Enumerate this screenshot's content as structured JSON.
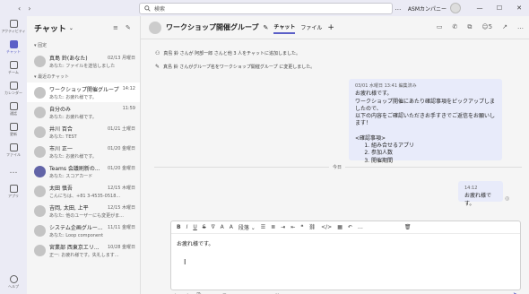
{
  "topbar": {
    "search_placeholder": "検索",
    "org_name": "ASMカンパニー",
    "more": "…",
    "minimize": "—",
    "maximize": "☐",
    "close": "✕"
  },
  "rail": {
    "items": [
      {
        "label": "アクティビティ",
        "icon": "bell-icon"
      },
      {
        "label": "チャット",
        "icon": "chat-icon"
      },
      {
        "label": "チーム",
        "icon": "teams-icon"
      },
      {
        "label": "カレンダー",
        "icon": "calendar-icon"
      },
      {
        "label": "通話",
        "icon": "phone-icon"
      },
      {
        "label": "更新",
        "icon": "feed-icon"
      },
      {
        "label": "ファイル",
        "icon": "file-icon"
      },
      {
        "label": "…",
        "icon": "more-icon"
      },
      {
        "label": "アプリ",
        "icon": "apps-icon"
      }
    ],
    "help": "ヘルプ"
  },
  "chatlist": {
    "title": "チャット",
    "pinned_label": "固定",
    "recent_label": "最近のチャット",
    "pinned": [
      {
        "name": "真島 鈴(あなた)",
        "sub": "あなた: ファイルを送信しました",
        "date": "02/13 月曜日"
      }
    ],
    "recent": [
      {
        "name": "ワークショップ開催グループ",
        "sub": "あなた: お疲れ様です。",
        "date": "14:12"
      },
      {
        "name": "自分のみ",
        "sub": "あなた: お疲れ様です。",
        "date": "11:59"
      },
      {
        "name": "井川 百合",
        "sub": "あなた: TEST",
        "date": "01/21 土曜日"
      },
      {
        "name": "市川 正一",
        "sub": "あなた: お疲れ様です。",
        "date": "01/20 金曜日"
      },
      {
        "name": "Teams 会議刷新の...",
        "sub": "あなた: スコアカード",
        "date": "01/20 金曜日"
      },
      {
        "name": "太田 慎吾",
        "sub": "こんにちは、+81 3-4535-0518...",
        "date": "12/15 木曜日"
      },
      {
        "name": "吉岡, 太田, 上平",
        "sub": "あなた: 他のユーザーにも変更がま...",
        "date": "12/15 木曜日"
      },
      {
        "name": "システム企画グルー...",
        "sub": "あなた: Loop component",
        "date": "11/11 金曜日"
      },
      {
        "name": "宮業部 西東京エリ...",
        "sub": "正一: お疲れ様です。失礼します...",
        "date": "10/28 金曜日"
      }
    ]
  },
  "chat": {
    "title": "ワークショップ開催グループ",
    "tabs": [
      "チャット",
      "ファイル"
    ],
    "add_tab": "+",
    "participants": "5",
    "system_messages": [
      "真島 鈴 さんが 阿部一郎 さんと他 3 人をチャットに追加しました。",
      "真島 鈴 さんがグループ名をワークショップ開催グループ に変更しました。"
    ],
    "msg1": {
      "meta": "03/01 水曜日 13:41  編集済み",
      "lines": [
        "お疲れ様です。",
        "ワークショップ開催にあたり確認事項をピックアップしましたので、",
        "以下の内容をご確認いただきお手すきでご返信をお願いします！",
        "",
        "<確認事項>"
      ],
      "list": [
        "組み合せるアプリ",
        "参加人数",
        "開催期間"
      ]
    },
    "divider": "今日",
    "msg2": {
      "meta": "14:12",
      "text": "お疲れ様です。"
    }
  },
  "compose": {
    "text": "お疲れ様です。",
    "style_label": "段落",
    "toolbar": [
      "B",
      "I",
      "U",
      "S",
      "∇",
      "A",
      "A"
    ]
  }
}
